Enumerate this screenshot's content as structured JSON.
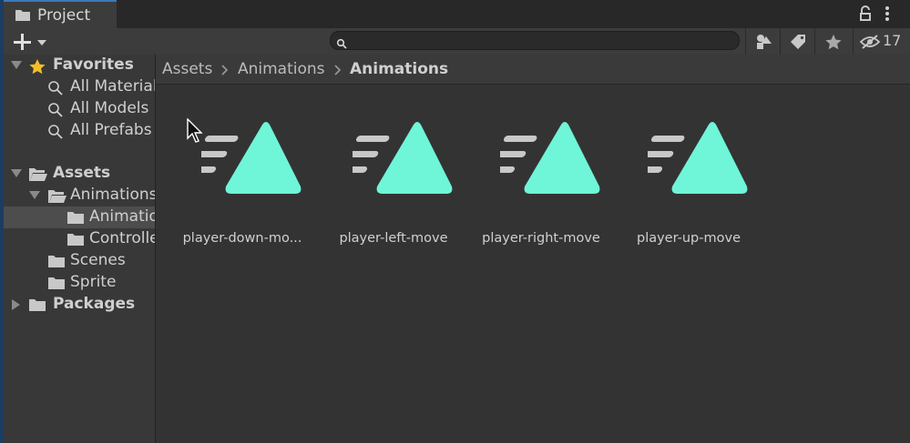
{
  "window": {
    "tab_label": "Project",
    "tab_icon": "folder-icon"
  },
  "toolbar": {
    "add_icon": "plus-icon",
    "search": {
      "value": "",
      "placeholder": ""
    },
    "hidden_count": "17"
  },
  "tree": {
    "favorites": {
      "label": "Favorites",
      "items": [
        {
          "label": "All Materials"
        },
        {
          "label": "All Models"
        },
        {
          "label": "All Prefabs"
        }
      ]
    },
    "assets": {
      "label": "Assets",
      "animations_folder": "Animations",
      "animations_sub": "Animations",
      "controllers": "Controllers",
      "scenes": "Scenes",
      "sprite": "Sprite"
    },
    "packages": "Packages"
  },
  "breadcrumb": [
    "Assets",
    "Animations",
    "Animations"
  ],
  "assets_grid": [
    {
      "name": "player-down-mo..."
    },
    {
      "name": "player-left-move"
    },
    {
      "name": "player-right-move"
    },
    {
      "name": "player-up-move"
    }
  ],
  "colors": {
    "accent": "#3a79bb",
    "animation_icon": "#6ff5d8",
    "star": "#f4bd2a"
  }
}
